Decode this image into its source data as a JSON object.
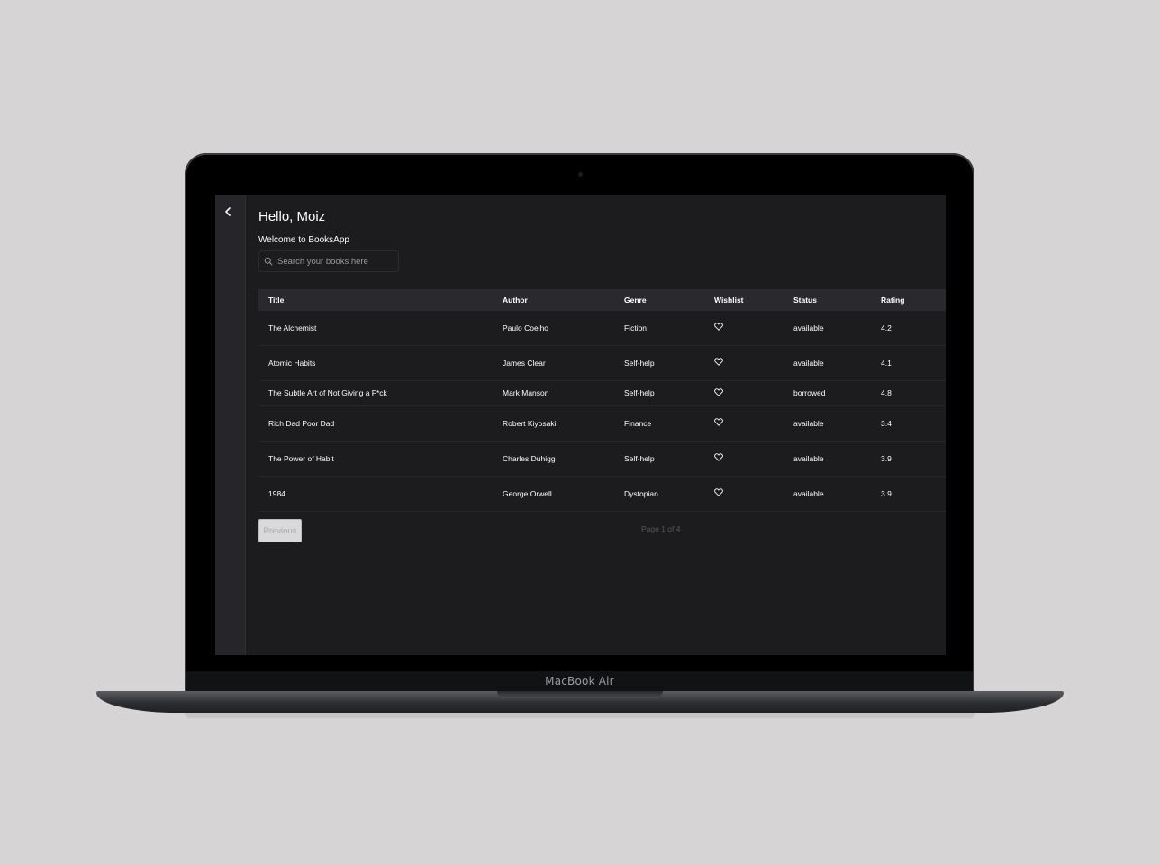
{
  "device": {
    "label": "MacBook Air"
  },
  "header": {
    "greeting": "Hello, Moiz",
    "welcome": "Welcome to BooksApp"
  },
  "search": {
    "placeholder": "Search your books here"
  },
  "icons": {
    "back": "chevron-left-icon",
    "search": "search-icon",
    "wishlist": "heart-outline-icon"
  },
  "table": {
    "columns": [
      "Title",
      "Author",
      "Genre",
      "Wishlist",
      "Status",
      "Rating"
    ],
    "rows": [
      {
        "title": "The Alchemist",
        "author": "Paulo Coelho",
        "genre": "Fiction",
        "status": "available",
        "rating": "4.2"
      },
      {
        "title": "Atomic Habits",
        "author": "James Clear",
        "genre": "Self-help",
        "status": "available",
        "rating": "4.1"
      },
      {
        "title": "The Subtle Art of Not Giving a F*ck",
        "author": "Mark Manson",
        "genre": "Self-help",
        "status": "borrowed",
        "rating": "4.8"
      },
      {
        "title": "Rich Dad Poor Dad",
        "author": "Robert Kiyosaki",
        "genre": "Finance",
        "status": "available",
        "rating": "3.4"
      },
      {
        "title": "The Power of Habit",
        "author": "Charles Duhigg",
        "genre": "Self-help",
        "status": "available",
        "rating": "3.9"
      },
      {
        "title": "1984",
        "author": "George Orwell",
        "genre": "Dystopian",
        "status": "available",
        "rating": "3.9"
      }
    ]
  },
  "pagination": {
    "previous_label": "Previous",
    "page_info": "Page 1 of 4"
  },
  "colors": {
    "background": "#d6d4d5",
    "screen": "#1c1c1e",
    "header_row": "#2a2a2e",
    "text": "#ffffff",
    "muted": "#55565c"
  }
}
